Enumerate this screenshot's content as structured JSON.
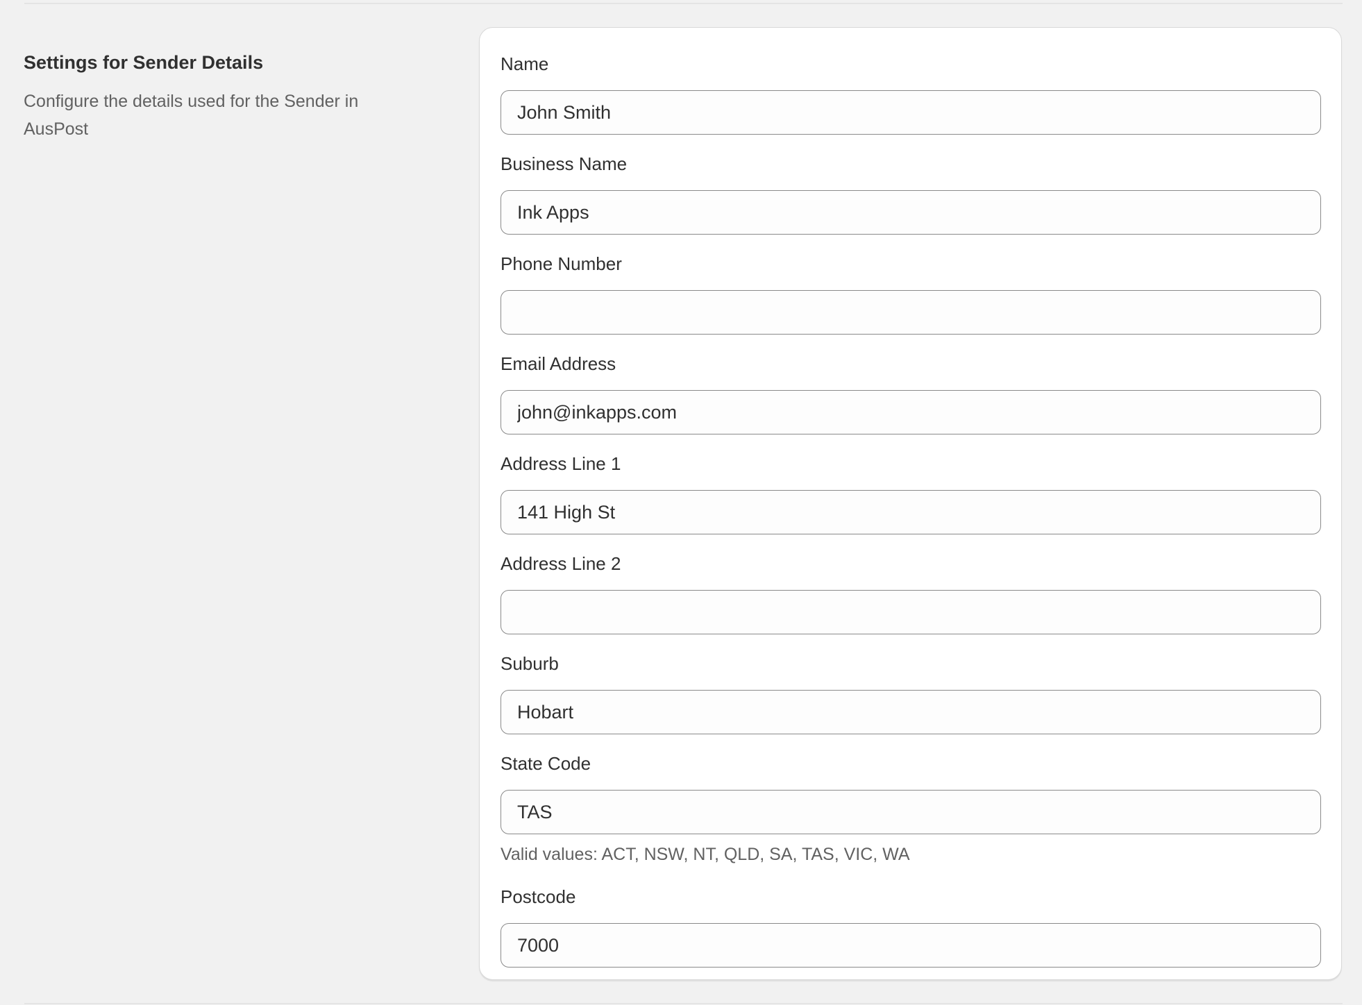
{
  "section": {
    "title": "Settings for Sender Details",
    "description": "Configure the details used for the Sender in AusPost"
  },
  "fields": [
    {
      "label": "Name",
      "value": "John Smith"
    },
    {
      "label": "Business Name",
      "value": "Ink Apps"
    },
    {
      "label": "Phone Number",
      "value": ""
    },
    {
      "label": "Email Address",
      "value": "john@inkapps.com"
    },
    {
      "label": "Address Line 1",
      "value": "141 High St"
    },
    {
      "label": "Address Line 2",
      "value": ""
    },
    {
      "label": "Suburb",
      "value": "Hobart"
    },
    {
      "label": "State Code",
      "value": "TAS",
      "help": "Valid values: ACT, NSW, NT, QLD, SA, TAS, VIC, WA"
    },
    {
      "label": "Postcode",
      "value": "7000"
    }
  ]
}
